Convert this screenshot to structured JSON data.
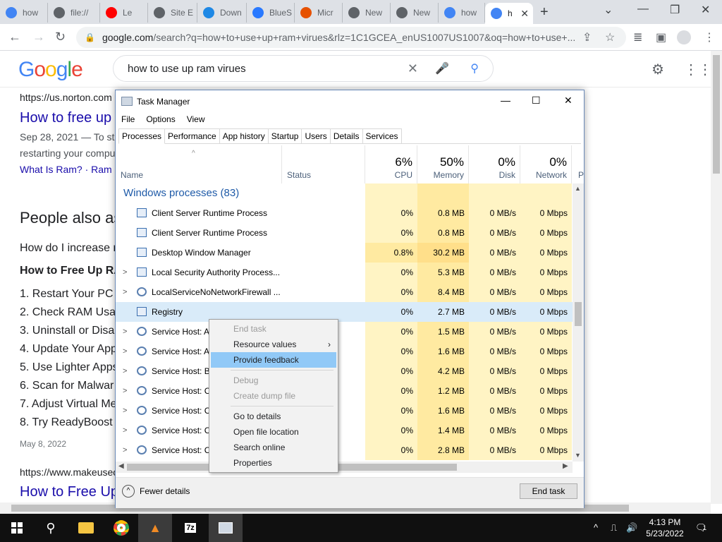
{
  "browser": {
    "tabs": [
      {
        "label": "how",
        "favicon": "google-favicon"
      },
      {
        "label": "file://",
        "favicon": "globe-favicon"
      },
      {
        "label": "Le",
        "favicon": "youtube-favicon"
      },
      {
        "label": "Site E",
        "favicon": "globe-favicon"
      },
      {
        "label": "Down",
        "favicon": "download-favicon"
      },
      {
        "label": "BlueS",
        "favicon": "bluestacks-favicon"
      },
      {
        "label": "Micr",
        "favicon": "microsoft-favicon"
      },
      {
        "label": "New",
        "favicon": "chrome-favicon"
      },
      {
        "label": "New",
        "favicon": "chrome-favicon"
      },
      {
        "label": "how",
        "favicon": "google-favicon"
      },
      {
        "label": "h",
        "favicon": "google-favicon",
        "active": true
      }
    ],
    "new_tab": "+",
    "url_host": "google.com",
    "url_rest": "/search?q=how+to+use+up+ram+virues&rlz=1C1GCEA_enUS1007US1007&oq=how+to+use+..."
  },
  "google": {
    "logo": "Google",
    "query": "how to use up ram virues"
  },
  "page": {
    "result1_url": "https://us.norton.com",
    "result1_title": "How to free up",
    "result1_snippet": "Sep 28, 2021 — To st",
    "result1_snippet2": "restarting your compu",
    "result1_sublinks": "What Is Ram? · Ram",
    "paa_heading": "People also as",
    "paa_q1": "How do I increase r",
    "featured_title": "How to Free Up RA",
    "steps": [
      "1. Restart Your PC",
      "2. Check RAM Usa",
      "3. Uninstall or Disa",
      "4. Update Your App",
      "5. Use Lighter Apps",
      "6. Scan for Malwar",
      "7. Adjust Virtual Me",
      "8. Try ReadyBoost"
    ],
    "date": "May 8, 2022",
    "result2_url": "https://www.makeuseo",
    "result2_title": "How to Free Up"
  },
  "taskmanager": {
    "title": "Task Manager",
    "menu": [
      "File",
      "Options",
      "View"
    ],
    "tabs": [
      "Processes",
      "Performance",
      "App history",
      "Startup",
      "Users",
      "Details",
      "Services"
    ],
    "columns": {
      "name": "Name",
      "status": "Status",
      "cpu_pct": "6%",
      "cpu": "CPU",
      "mem_pct": "50%",
      "mem": "Memory",
      "disk_pct": "0%",
      "disk": "Disk",
      "net_pct": "0%",
      "net": "Network",
      "power_partial": "P"
    },
    "group": "Windows processes (83)",
    "processes": [
      {
        "name": "Client Server Runtime Process",
        "cpu": "0%",
        "mem": "0.8 MB",
        "disk": "0 MB/s",
        "net": "0 Mbps",
        "expand": false,
        "icon": "window"
      },
      {
        "name": "Client Server Runtime Process",
        "cpu": "0%",
        "mem": "0.8 MB",
        "disk": "0 MB/s",
        "net": "0 Mbps",
        "expand": false,
        "icon": "window"
      },
      {
        "name": "Desktop Window Manager",
        "cpu": "0.8%",
        "mem": "30.2 MB",
        "disk": "0 MB/s",
        "net": "0 Mbps",
        "expand": false,
        "icon": "window"
      },
      {
        "name": "Local Security Authority Process...",
        "cpu": "0%",
        "mem": "5.3 MB",
        "disk": "0 MB/s",
        "net": "0 Mbps",
        "expand": true,
        "icon": "window"
      },
      {
        "name": "LocalServiceNoNetworkFirewall ...",
        "cpu": "0%",
        "mem": "8.4 MB",
        "disk": "0 MB/s",
        "net": "0 Mbps",
        "expand": true,
        "icon": "gear"
      },
      {
        "name": "Registry",
        "cpu": "0%",
        "mem": "2.7 MB",
        "disk": "0 MB/s",
        "net": "0 Mbps",
        "expand": false,
        "icon": "window",
        "selected": true
      },
      {
        "name": "Service Host: A",
        "cpu": "0%",
        "mem": "1.5 MB",
        "disk": "0 MB/s",
        "net": "0 Mbps",
        "expand": true,
        "icon": "gear"
      },
      {
        "name": "Service Host: A",
        "cpu": "0%",
        "mem": "1.6 MB",
        "disk": "0 MB/s",
        "net": "0 Mbps",
        "expand": true,
        "icon": "gear"
      },
      {
        "name": "Service Host: Ba",
        "cpu": "0%",
        "mem": "4.2 MB",
        "disk": "0 MB/s",
        "net": "0 Mbps",
        "expand": true,
        "icon": "gear"
      },
      {
        "name": "Service Host: C",
        "cpu": "0%",
        "mem": "1.2 MB",
        "disk": "0 MB/s",
        "net": "0 Mbps",
        "expand": true,
        "icon": "gear"
      },
      {
        "name": "Service Host: C",
        "cpu": "0%",
        "mem": "1.6 MB",
        "disk": "0 MB/s",
        "net": "0 Mbps",
        "expand": true,
        "icon": "gear"
      },
      {
        "name": "Service Host: C",
        "cpu": "0%",
        "mem": "1.4 MB",
        "disk": "0 MB/s",
        "net": "0 Mbps",
        "expand": true,
        "icon": "gear"
      },
      {
        "name": "Service Host: C",
        "cpu": "0%",
        "mem": "2.8 MB",
        "disk": "0 MB/s",
        "net": "0 Mbps",
        "expand": true,
        "icon": "gear"
      }
    ],
    "fewer_details": "Fewer details",
    "end_task": "End task"
  },
  "context_menu": {
    "items": [
      {
        "label": "End task",
        "disabled": true
      },
      {
        "label": "Resource values",
        "submenu": true
      },
      {
        "label": "Provide feedback",
        "selected": true
      },
      {
        "separator": true
      },
      {
        "label": "Debug",
        "disabled": true
      },
      {
        "label": "Create dump file",
        "disabled": true
      },
      {
        "separator": true
      },
      {
        "label": "Go to details"
      },
      {
        "label": "Open file location"
      },
      {
        "label": "Search online"
      },
      {
        "label": "Properties"
      }
    ]
  },
  "taskbar": {
    "time": "4:13 PM",
    "date": "5/23/2022",
    "notifications": "1",
    "colors": {
      "bg": "#101010",
      "active": "#3b3b3b"
    }
  }
}
